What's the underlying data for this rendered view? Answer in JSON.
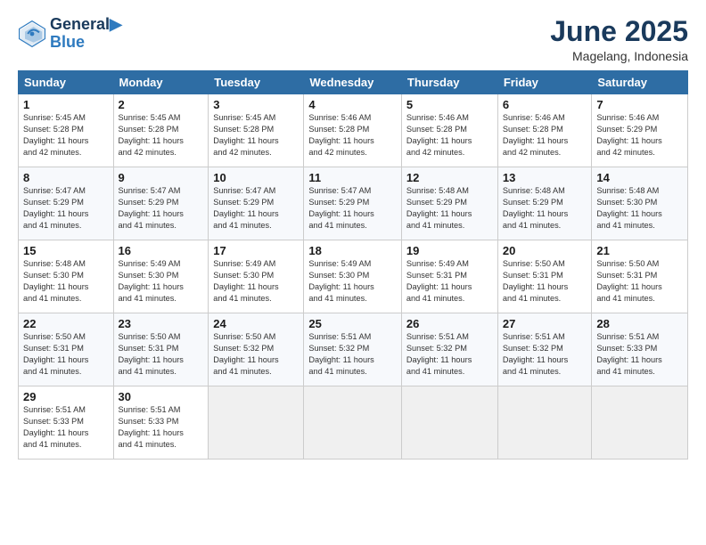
{
  "header": {
    "logo_line1": "General",
    "logo_line2": "Blue",
    "title": "June 2025",
    "subtitle": "Magelang, Indonesia"
  },
  "calendar": {
    "days_of_week": [
      "Sunday",
      "Monday",
      "Tuesday",
      "Wednesday",
      "Thursday",
      "Friday",
      "Saturday"
    ],
    "weeks": [
      [
        {
          "day": "1",
          "sunrise": "5:45 AM",
          "sunset": "5:28 PM",
          "daylight": "11 hours and 42 minutes."
        },
        {
          "day": "2",
          "sunrise": "5:45 AM",
          "sunset": "5:28 PM",
          "daylight": "11 hours and 42 minutes."
        },
        {
          "day": "3",
          "sunrise": "5:45 AM",
          "sunset": "5:28 PM",
          "daylight": "11 hours and 42 minutes."
        },
        {
          "day": "4",
          "sunrise": "5:46 AM",
          "sunset": "5:28 PM",
          "daylight": "11 hours and 42 minutes."
        },
        {
          "day": "5",
          "sunrise": "5:46 AM",
          "sunset": "5:28 PM",
          "daylight": "11 hours and 42 minutes."
        },
        {
          "day": "6",
          "sunrise": "5:46 AM",
          "sunset": "5:28 PM",
          "daylight": "11 hours and 42 minutes."
        },
        {
          "day": "7",
          "sunrise": "5:46 AM",
          "sunset": "5:29 PM",
          "daylight": "11 hours and 42 minutes."
        }
      ],
      [
        {
          "day": "8",
          "sunrise": "5:47 AM",
          "sunset": "5:29 PM",
          "daylight": "11 hours and 41 minutes."
        },
        {
          "day": "9",
          "sunrise": "5:47 AM",
          "sunset": "5:29 PM",
          "daylight": "11 hours and 41 minutes."
        },
        {
          "day": "10",
          "sunrise": "5:47 AM",
          "sunset": "5:29 PM",
          "daylight": "11 hours and 41 minutes."
        },
        {
          "day": "11",
          "sunrise": "5:47 AM",
          "sunset": "5:29 PM",
          "daylight": "11 hours and 41 minutes."
        },
        {
          "day": "12",
          "sunrise": "5:48 AM",
          "sunset": "5:29 PM",
          "daylight": "11 hours and 41 minutes."
        },
        {
          "day": "13",
          "sunrise": "5:48 AM",
          "sunset": "5:29 PM",
          "daylight": "11 hours and 41 minutes."
        },
        {
          "day": "14",
          "sunrise": "5:48 AM",
          "sunset": "5:30 PM",
          "daylight": "11 hours and 41 minutes."
        }
      ],
      [
        {
          "day": "15",
          "sunrise": "5:48 AM",
          "sunset": "5:30 PM",
          "daylight": "11 hours and 41 minutes."
        },
        {
          "day": "16",
          "sunrise": "5:49 AM",
          "sunset": "5:30 PM",
          "daylight": "11 hours and 41 minutes."
        },
        {
          "day": "17",
          "sunrise": "5:49 AM",
          "sunset": "5:30 PM",
          "daylight": "11 hours and 41 minutes."
        },
        {
          "day": "18",
          "sunrise": "5:49 AM",
          "sunset": "5:30 PM",
          "daylight": "11 hours and 41 minutes."
        },
        {
          "day": "19",
          "sunrise": "5:49 AM",
          "sunset": "5:31 PM",
          "daylight": "11 hours and 41 minutes."
        },
        {
          "day": "20",
          "sunrise": "5:50 AM",
          "sunset": "5:31 PM",
          "daylight": "11 hours and 41 minutes."
        },
        {
          "day": "21",
          "sunrise": "5:50 AM",
          "sunset": "5:31 PM",
          "daylight": "11 hours and 41 minutes."
        }
      ],
      [
        {
          "day": "22",
          "sunrise": "5:50 AM",
          "sunset": "5:31 PM",
          "daylight": "11 hours and 41 minutes."
        },
        {
          "day": "23",
          "sunrise": "5:50 AM",
          "sunset": "5:31 PM",
          "daylight": "11 hours and 41 minutes."
        },
        {
          "day": "24",
          "sunrise": "5:50 AM",
          "sunset": "5:32 PM",
          "daylight": "11 hours and 41 minutes."
        },
        {
          "day": "25",
          "sunrise": "5:51 AM",
          "sunset": "5:32 PM",
          "daylight": "11 hours and 41 minutes."
        },
        {
          "day": "26",
          "sunrise": "5:51 AM",
          "sunset": "5:32 PM",
          "daylight": "11 hours and 41 minutes."
        },
        {
          "day": "27",
          "sunrise": "5:51 AM",
          "sunset": "5:32 PM",
          "daylight": "11 hours and 41 minutes."
        },
        {
          "day": "28",
          "sunrise": "5:51 AM",
          "sunset": "5:33 PM",
          "daylight": "11 hours and 41 minutes."
        }
      ],
      [
        {
          "day": "29",
          "sunrise": "5:51 AM",
          "sunset": "5:33 PM",
          "daylight": "11 hours and 41 minutes."
        },
        {
          "day": "30",
          "sunrise": "5:51 AM",
          "sunset": "5:33 PM",
          "daylight": "11 hours and 41 minutes."
        },
        null,
        null,
        null,
        null,
        null
      ]
    ]
  }
}
